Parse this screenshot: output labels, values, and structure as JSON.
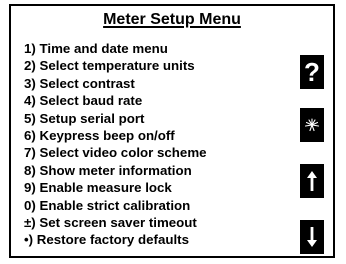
{
  "title": "Meter Setup Menu",
  "menu_items": [
    "1) Time and date menu",
    "2) Select temperature units",
    "3) Select contrast",
    "4) Select baud rate",
    "5) Setup serial port",
    "6) Keypress beep on/off",
    "7) Select video color scheme",
    "8) Show meter information",
    "9) Enable measure lock",
    "0) Enable strict calibration",
    "±) Set screen saver timeout",
    "•) Restore factory defaults"
  ],
  "side_buttons": {
    "help_glyph": "?",
    "icons": [
      "question-mark-icon",
      "backlight-icon",
      "arrow-up-icon",
      "arrow-down-icon"
    ]
  },
  "colors": {
    "background": "#ffffff",
    "foreground": "#000000",
    "button_fill": "#000000",
    "button_glyph": "#ffffff"
  }
}
